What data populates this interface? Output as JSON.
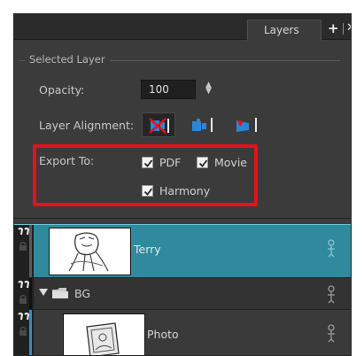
{
  "tab": {
    "label": "Layers",
    "add_icon": "plus-icon",
    "close_icon": "close-icon"
  },
  "layer_properties": {
    "group_title": "Selected Layer",
    "opacity_label": "Opacity:",
    "opacity_value": "100",
    "alignment_label": "Layer Alignment:",
    "alignment_buttons": [
      {
        "icon": "align-disabled-icon",
        "active": true
      },
      {
        "icon": "align-facing-camera-icon",
        "active": false
      },
      {
        "icon": "align-angled-icon",
        "active": false
      }
    ],
    "export_label": "Export To:",
    "export_options": [
      {
        "label": "PDF",
        "checked": true
      },
      {
        "label": "Movie",
        "checked": true
      },
      {
        "label": "Harmony",
        "checked": true
      }
    ]
  },
  "layers": [
    {
      "name": "Terry",
      "type": "drawing",
      "selected": true,
      "strip_color": "#4a4a4a"
    },
    {
      "name": "BG",
      "type": "group",
      "expanded": true,
      "selected": false,
      "strip_color": "#111111"
    },
    {
      "name": "Photo",
      "type": "image",
      "selected": false,
      "strip_color": "#2a8fd6"
    }
  ],
  "colors": {
    "highlight": "#e8101a",
    "selection": "#2e8a9c",
    "panel_bg": "#3b3b3b"
  }
}
